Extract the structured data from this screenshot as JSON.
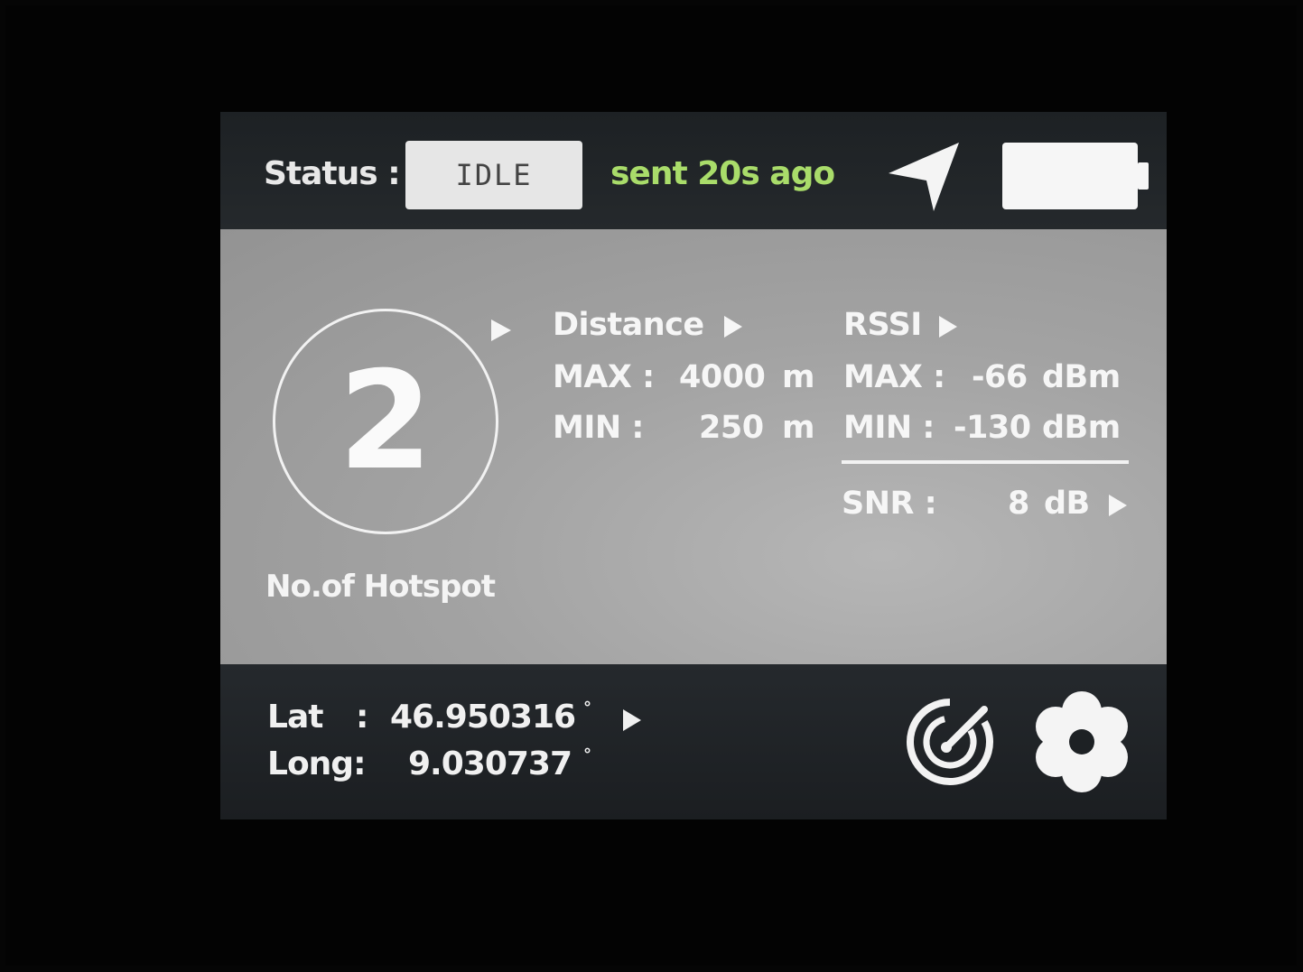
{
  "header": {
    "status_label": "Status :",
    "status_value": "IDLE",
    "sent_text": "sent 20s ago",
    "nav_icon": "navigation-arrow-icon",
    "battery_icon": "battery-full-icon"
  },
  "hotspot": {
    "count": "2",
    "label": "No.of Hotspot"
  },
  "distance": {
    "title": "Distance",
    "max_label": "MAX :",
    "max_value": "4000",
    "max_unit": "m",
    "min_label": "MIN :",
    "min_value": "250",
    "min_unit": "m"
  },
  "rssi": {
    "title": "RSSI",
    "max_label": "MAX :",
    "max_value": "-66",
    "max_unit": "dBm",
    "min_label": "MIN :",
    "min_value": "-130",
    "min_unit": "dBm"
  },
  "snr": {
    "label": "SNR :",
    "value": "8",
    "unit": "dB"
  },
  "location": {
    "lat_label": "Lat",
    "lat_sep": ":",
    "lat_value": "46.950316",
    "lat_unit": "°",
    "long_label": "Long:",
    "long_value": "9.030737",
    "long_unit": "°"
  },
  "footer": {
    "radar_icon": "radar-scan-icon",
    "settings_icon": "gear-icon"
  },
  "colors": {
    "sent_text": "#a9dc6a",
    "panel": "#a3a3a3",
    "bars": "#1d2124"
  }
}
